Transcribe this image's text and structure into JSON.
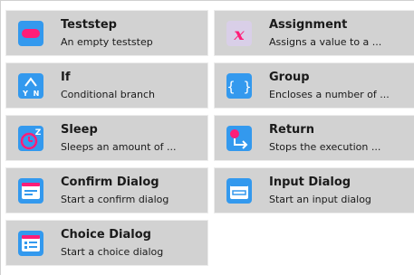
{
  "steps": [
    {
      "title": "Teststep",
      "desc": "An empty teststep",
      "icon": "teststep-icon"
    },
    {
      "title": "Assignment",
      "desc": "Assigns a value to a ...",
      "icon": "variable-x-icon"
    },
    {
      "title": "If",
      "desc": "Conditional branch",
      "icon": "branch-y-n-icon"
    },
    {
      "title": "Group",
      "desc": "Encloses a number of ...",
      "icon": "braces-icon"
    },
    {
      "title": "Sleep",
      "desc": "Sleeps an amount of ...",
      "icon": "stopwatch-z-icon"
    },
    {
      "title": "Return",
      "desc": "Stops the execution ...",
      "icon": "return-arrow-icon"
    },
    {
      "title": "Confirm Dialog",
      "desc": "Start a confirm dialog",
      "icon": "confirm-dialog-icon"
    },
    {
      "title": "Input Dialog",
      "desc": "Start an input dialog",
      "icon": "input-dialog-icon"
    },
    {
      "title": "Choice Dialog",
      "desc": "Start a choice dialog",
      "icon": "choice-dialog-icon"
    }
  ],
  "colors": {
    "tile_bg": "#d2d2d2",
    "icon_blue": "#3399ee",
    "icon_pink": "#ff1d78",
    "icon_lavender": "#d9cfe8"
  }
}
